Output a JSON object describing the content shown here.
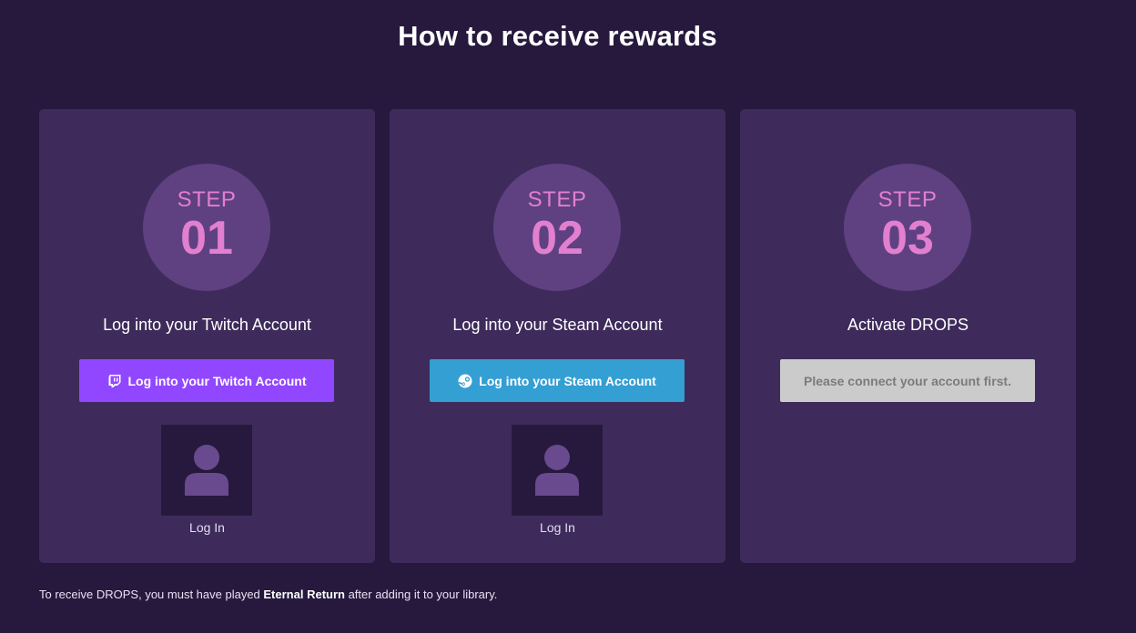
{
  "page": {
    "title": "How to receive rewards"
  },
  "steps": [
    {
      "step_word": "STEP",
      "number": "01",
      "heading": "Log into your Twitch Account",
      "button_label": "Log into your Twitch Account",
      "button_icon": "twitch-icon",
      "button_color": "#9147ff",
      "avatar_icon": "user-avatar-icon",
      "link_label": "Log In"
    },
    {
      "step_word": "STEP",
      "number": "02",
      "heading": "Log into your Steam Account",
      "button_label": "Log into your Steam Account",
      "button_icon": "steam-icon",
      "button_color": "#349fd3",
      "avatar_icon": "user-avatar-icon",
      "link_label": "Log In"
    },
    {
      "step_word": "STEP",
      "number": "03",
      "heading": "Activate DROPS",
      "button_label": "Please connect your account first.",
      "button_color": "#cbcbcb",
      "button_disabled": true
    }
  ],
  "footnote": {
    "before": "To receive DROPS, you must have played ",
    "game": "Eternal Return",
    "after": " after adding it to your library."
  },
  "colors": {
    "background": "#26193d",
    "card": "#3e2b5b",
    "step_circle": "#5f4182",
    "step_text": "#e27fcf"
  }
}
